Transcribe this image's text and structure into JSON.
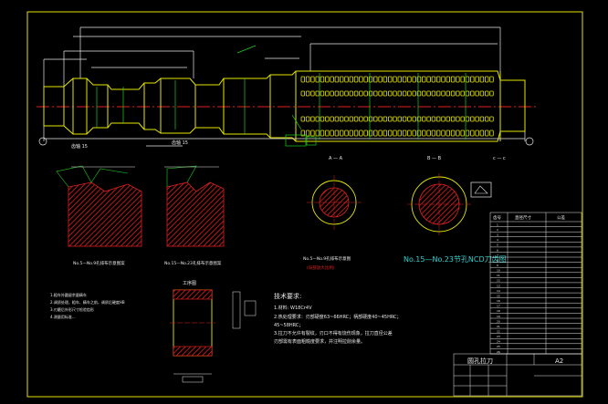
{
  "drawing": {
    "section_marks": {
      "a": "A — A",
      "b": "B — B",
      "c": "c — c",
      "d": "D"
    },
    "view_labels": {
      "left": "齿轴 15",
      "right": "齿轴 15",
      "detail": "1:20"
    },
    "detail_captions": {
      "left": "No.5—No.9孔排布示意图案",
      "middle": "No.15—No.23孔排布示意图案",
      "right": "No.5—No.9孔排布示意图",
      "right_sub": "(局部放大比例)"
    },
    "big_label": "No.15—No.23节孔NCD刀齿图",
    "process_label": "工序图",
    "process_notes": [
      "1.粗车外圆留余量精车",
      "2.调质处理，粗车、精车之前，调质后硬度HB",
      "3.刃磨后外形尺寸检验齿形",
      "4.测量用标准..."
    ],
    "tech_title": "技术要求:",
    "tech_lines": [
      "1.材料: W18Cr4V",
      "2.热处理要求：刃部硬度63~66HRC；柄部硬度40~45HRC；",
      "45~58HRC；",
      "3.拉刀不允许有裂纹，刃口不得有烧伤现象，拉刀直径公差",
      "刃部需有表面粗糙度要求，并注明拉削余量。"
    ],
    "title_block": {
      "name": "圆孔拉刀",
      "size": "A2"
    },
    "table": {
      "headers": [
        "齿号",
        "直径尺寸",
        "公差"
      ],
      "rows": [
        "1",
        "2",
        "3",
        "4",
        "5",
        "6",
        "7",
        "8",
        "9",
        "10",
        "11",
        "12",
        "13",
        "14",
        "15",
        "16",
        "17",
        "18",
        "19",
        "20",
        "21",
        "22",
        "23",
        "24",
        "25",
        "26"
      ]
    },
    "colors": {
      "background": "#000000",
      "line_white": "#e8e8e8",
      "line_yellow": "#e6e600",
      "line_red": "#e02020",
      "line_green": "#20d020",
      "line_cyan": "#30d0d0"
    }
  }
}
